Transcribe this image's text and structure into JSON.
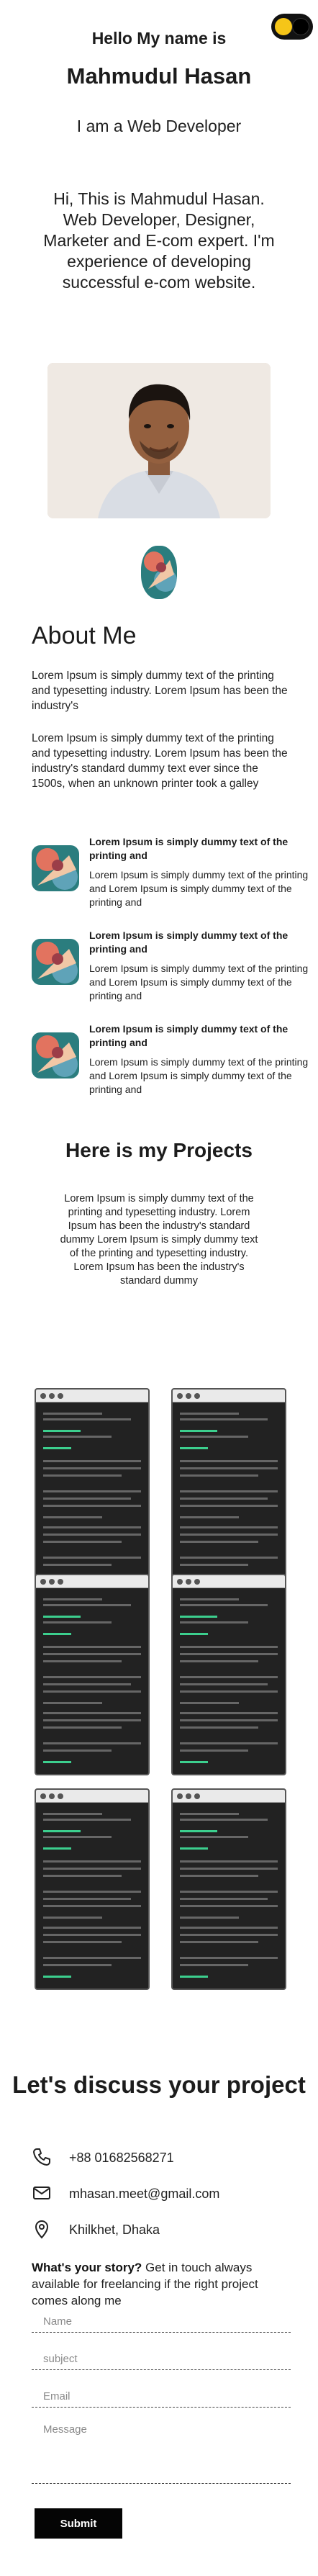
{
  "hero": {
    "greeting": "Hello My name is",
    "name": "Mahmudul Hasan",
    "role": "I am a Web Developer",
    "intro": "Hi, This is Mahmudul Hasan. Web Developer, Designer, Marketer and E-com expert. I'm experience of developing successful e-com website."
  },
  "about": {
    "title": "About Me",
    "para1": "Lorem Ipsum is simply dummy text of the printing and typesetting industry. Lorem Ipsum has been the industry's",
    "para2": "Lorem Ipsum is simply dummy text of the printing and typesetting industry. Lorem Ipsum has been the industry's standard dummy text ever since the 1500s, when an unknown printer took a galley",
    "features": [
      {
        "title": "Lorem Ipsum is simply dummy text of the printing and",
        "text": "Lorem Ipsum is simply dummy text of the printing and Lorem Ipsum is simply dummy text of the printing and"
      },
      {
        "title": "Lorem Ipsum is simply dummy text of the printing and",
        "text": "Lorem Ipsum is simply dummy text of the printing and Lorem Ipsum is simply dummy text of the printing and"
      },
      {
        "title": "Lorem Ipsum is simply dummy text of the printing and",
        "text": "Lorem Ipsum is simply dummy text of the printing and Lorem Ipsum is simply dummy text of the printing and"
      }
    ]
  },
  "projects": {
    "title": "Here is my Projects",
    "text": "Lorem Ipsum is simply dummy text of the printing and typesetting industry. Lorem Ipsum has been the industry's standard dummy Lorem Ipsum is simply dummy text of the printing and typesetting industry. Lorem Ipsum has been the industry's standard dummy"
  },
  "contact": {
    "title": "Let's discuss your project",
    "phone": "+88 01682568271",
    "email": "mhasan.meet@gmail.com",
    "location": "Khilkhet, Dhaka",
    "story_bold": "What's your story?",
    "story_text": " Get in touch always available for freelancing if the right project comes along me"
  },
  "form": {
    "name_placeholder": "Name",
    "subject_placeholder": "subject",
    "email_placeholder": "Email",
    "message_placeholder": "Message",
    "submit_label": "Submit"
  },
  "colors": {
    "accent_green": "#3ccf8e",
    "toggle_yellow": "#f5c518",
    "dark": "#050505"
  }
}
